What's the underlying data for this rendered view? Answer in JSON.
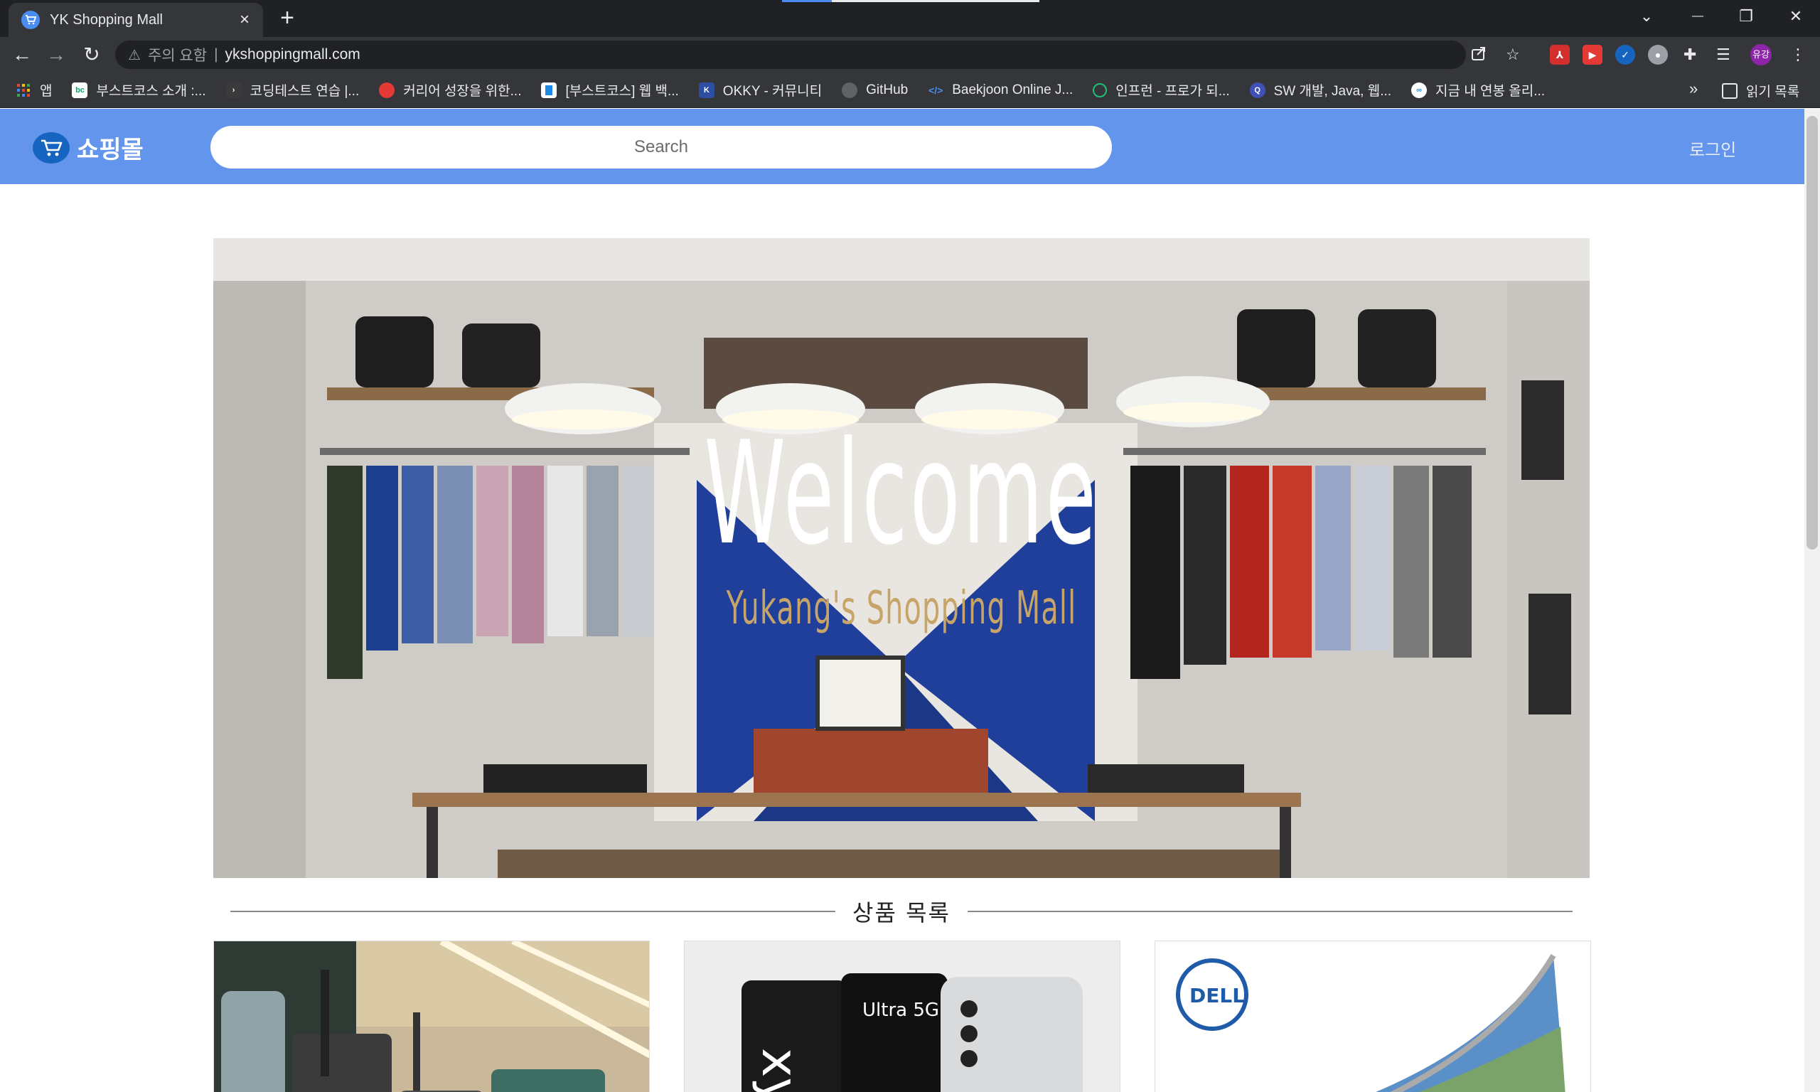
{
  "browser": {
    "tab_title": "YK Shopping Mall",
    "tab_close": "×",
    "new_tab": "+",
    "controls": {
      "tab_list": "⌄",
      "minimize": "—",
      "restore": "❐",
      "close": "✕"
    },
    "nav": {
      "back": "←",
      "forward": "→",
      "reload": "↻"
    },
    "omnibox": {
      "warning": "주의 요함",
      "separator": "|",
      "url": "ykshoppingmall.com"
    },
    "toolbar_icons": [
      "share-icon",
      "star-icon",
      "pdf-extension-icon",
      "video-extension-icon",
      "check-extension-icon",
      "circle-extension-icon",
      "puzzle-icon",
      "reading-queue-icon",
      "profile-avatar",
      "menu-icon"
    ],
    "profile_label": "유강",
    "bookmarks": [
      {
        "label": "앱",
        "icon": "apps-grid-icon",
        "color": "#ea4335"
      },
      {
        "label": "부스트코스 소개 :...",
        "icon": "bc-icon",
        "color": "#00a86b"
      },
      {
        "label": "코딩테스트 연습 |...",
        "icon": "programmers-icon",
        "color": "#3a3a3a"
      },
      {
        "label": "커리어 성장을 위한...",
        "icon": "career-icon",
        "color": "#e53935"
      },
      {
        "label": "[부스트코스] 웹 백...",
        "icon": "boostcourse-icon",
        "color": "#1e88e5"
      },
      {
        "label": "OKKY - 커뮤니티",
        "icon": "okky-icon",
        "color": "#2d4ea2"
      },
      {
        "label": "GitHub",
        "icon": "github-icon",
        "color": "#24292e"
      },
      {
        "label": "Baekjoon Online J...",
        "icon": "baekjoon-icon",
        "color": "#0076c0"
      },
      {
        "label": "인프런 - 프로가 되...",
        "icon": "inflearn-icon",
        "color": "#1dc078"
      },
      {
        "label": "SW 개발, Java, 웹...",
        "icon": "q-icon",
        "color": "#3f51b5"
      },
      {
        "label": "지금 내 연봉 올리...",
        "icon": "salary-icon",
        "color": "#ffffff"
      }
    ],
    "bookmarks_more": "»",
    "reading_list": "읽기 목록"
  },
  "site": {
    "logo_text": "쇼핑몰",
    "search_placeholder": "Search",
    "login_label": "로그인",
    "accent_color": "#6495ed",
    "hero": {
      "title": "Welcome",
      "subtitle": "Yukang's Shopping Mall"
    },
    "section_title": "상품 목록",
    "products": [
      {
        "image": "tumbler-cups-photo"
      },
      {
        "image": "galaxy-s21-ultra-photo"
      },
      {
        "image": "dell-curved-monitor-photo"
      }
    ]
  }
}
